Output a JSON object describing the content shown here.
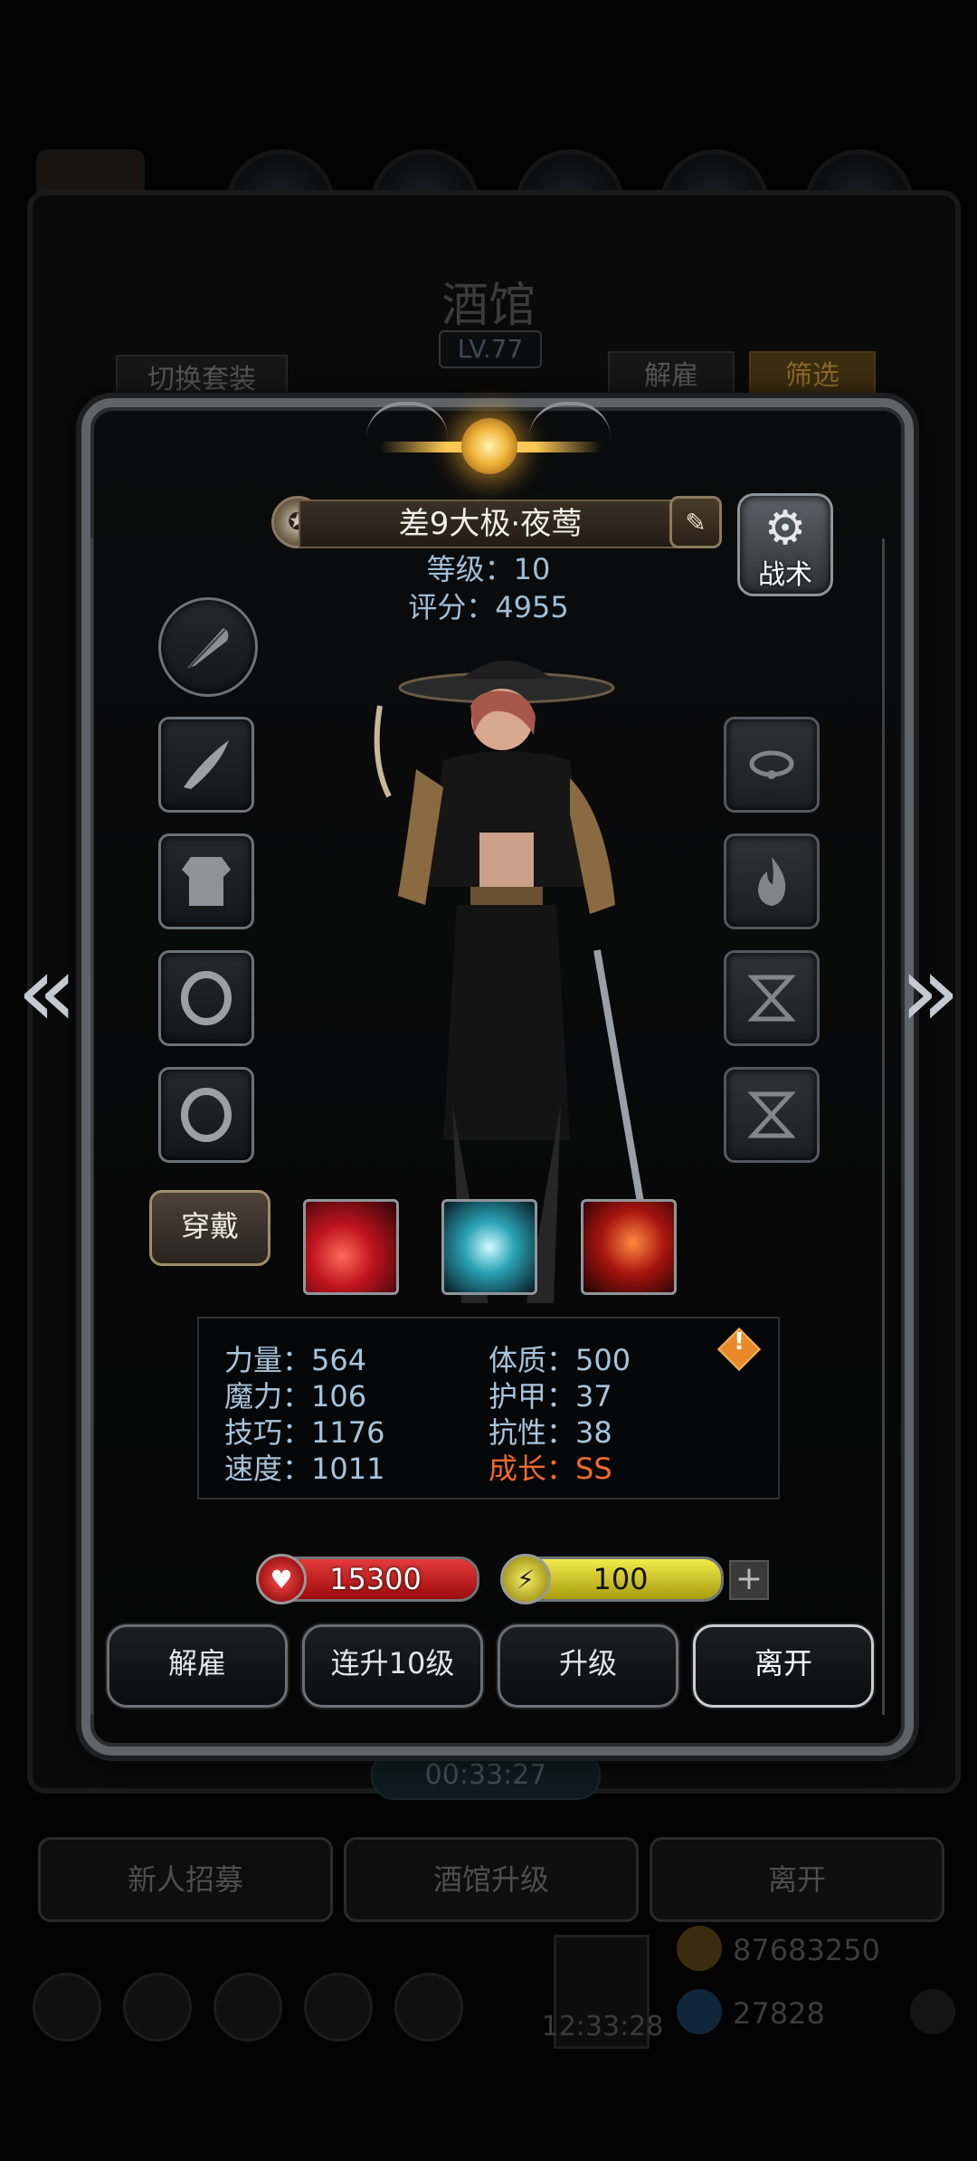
{
  "background": {
    "title": "酒馆",
    "level": "LV.77",
    "switch_set_label": "切换套装",
    "dismiss_label": "解雇",
    "filter_label": "筛选",
    "timer": "00:33:27",
    "recruit_label": "新人招募",
    "upgrade_tavern_label": "酒馆升级",
    "leave_label": "离开",
    "gift_timer": "12:33:28",
    "gold": "87683250",
    "gems": "27828"
  },
  "hero": {
    "name": "差9大极·夜莺",
    "level_text": "等级：10",
    "score_text": "评分：4955",
    "tactic_label": "战术",
    "wear_label": "穿戴"
  },
  "attributes": {
    "strength": "力量：564",
    "magic": "魔力：106",
    "skill": "技巧：1176",
    "speed": "速度：1011",
    "constitution": "体质：500",
    "armor": "护甲：37",
    "resist": "抗性：38",
    "growth": "成长：SS"
  },
  "bars": {
    "hp": "15300",
    "hp_fill": 1.0,
    "energy": "100",
    "energy_fill": 1.0
  },
  "actions": {
    "dismiss": "解雇",
    "level_up_10": "连升10级",
    "upgrade": "升级",
    "leave": "离开"
  },
  "colors": {
    "hp": "#d11a1a",
    "energy": "#e0d51a",
    "growth": "#f06a2a",
    "attr_text": "#a7c4dc"
  }
}
